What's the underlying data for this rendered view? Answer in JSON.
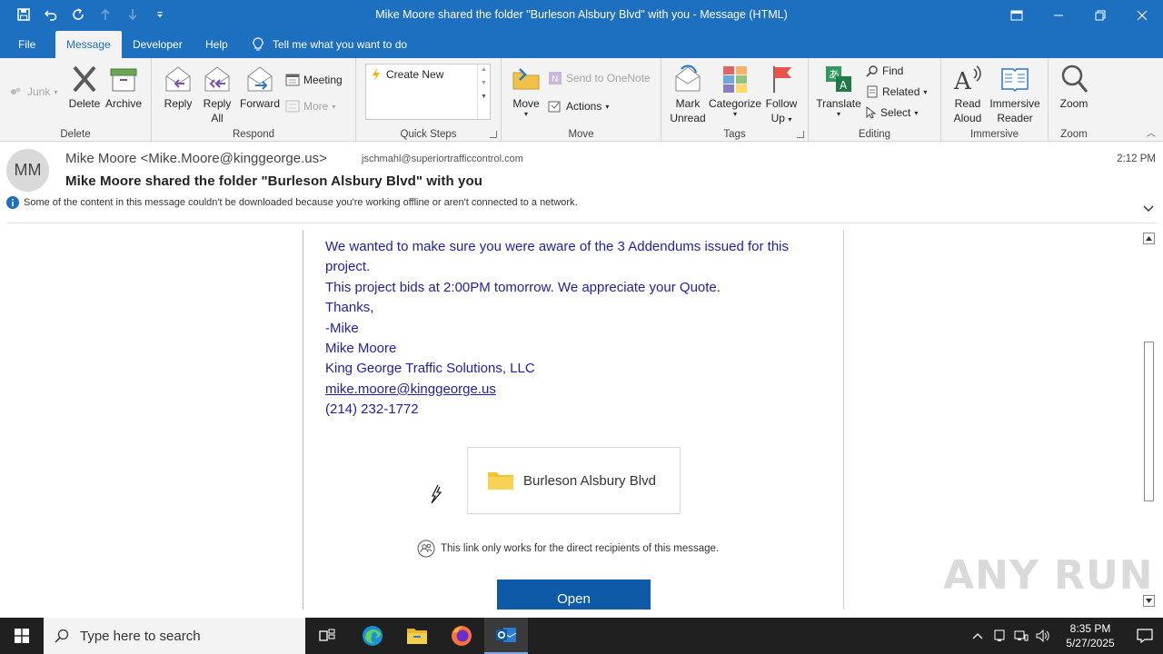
{
  "window": {
    "title": "Mike Moore shared the folder \"Burleson Alsbury Blvd\" with you  -  Message (HTML)"
  },
  "tabs": [
    {
      "label": "File"
    },
    {
      "label": "Message"
    },
    {
      "label": "Developer"
    },
    {
      "label": "Help"
    }
  ],
  "tell_me": "Tell me what you want to do",
  "ribbon": {
    "delete_group": {
      "label": "Delete",
      "junk": "Junk",
      "delete": "Delete",
      "archive": "Archive"
    },
    "respond_group": {
      "label": "Respond",
      "reply": "Reply",
      "reply_all_1": "Reply",
      "reply_all_2": "All",
      "forward": "Forward",
      "meeting": "Meeting",
      "more": "More"
    },
    "quicksteps_group": {
      "label": "Quick Steps",
      "create_new": "Create New"
    },
    "move_group": {
      "label": "Move",
      "move": "Move",
      "onenote": "Send to OneNote",
      "actions": "Actions"
    },
    "tags_group": {
      "label": "Tags",
      "mark_unread_1": "Mark",
      "mark_unread_2": "Unread",
      "categorize": "Categorize",
      "follow_up_1": "Follow",
      "follow_up_2": "Up"
    },
    "editing_group": {
      "label": "Editing",
      "translate": "Translate",
      "find": "Find",
      "related": "Related",
      "select": "Select"
    },
    "immersive_group": {
      "label": "Immersive",
      "read_aloud_1": "Read",
      "read_aloud_2": "Aloud",
      "immersive_reader_1": "Immersive",
      "immersive_reader_2": "Reader"
    },
    "zoom_group": {
      "label": "Zoom",
      "zoom": "Zoom"
    }
  },
  "header": {
    "avatar_initials": "MM",
    "from": "Mike Moore <Mike.Moore@kinggeorge.us>",
    "to": "jschmahl@superiortrafficcontrol.com",
    "time": "2:12 PM",
    "subject": "Mike Moore shared the folder \"Burleson Alsbury Blvd\" with you",
    "info": "Some of the content in this message couldn't be downloaded because you're working offline or aren't connected to a network."
  },
  "body": {
    "line1": "We wanted to make sure you were aware of the 3 Addendums issued for this",
    "line2": "project.",
    "line3": "This project bids at 2:00PM tomorrow. We appreciate your Quote.",
    "line4": "Thanks,",
    "line5": "-Mike",
    "line6": "Mike Moore",
    "line7": "King George Traffic Solutions, LLC",
    "email_link": "mike.moore@kinggeorge.us",
    "phone": "(214) 232-1772",
    "folder_name": "Burleson Alsbury Blvd",
    "direct_note": "This link only works for the direct recipients of this message.",
    "open_button": "Open"
  },
  "watermark": "ANY RUN",
  "taskbar": {
    "search_placeholder": "Type here to search",
    "time": "8:35 PM",
    "date": "5/27/2025"
  },
  "colors": {
    "title_blue": "#1d6fc0",
    "body_text": "#1f1fa5",
    "open_button": "#0f5aa8"
  }
}
